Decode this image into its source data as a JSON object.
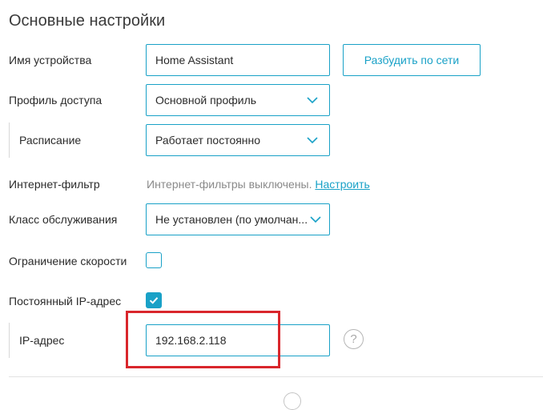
{
  "section": {
    "title": "Основные настройки"
  },
  "device_name": {
    "label": "Имя устройства",
    "value": "Home Assistant",
    "wol_button": "Разбудить по сети"
  },
  "access_profile": {
    "label": "Профиль доступа",
    "value": "Основной профиль"
  },
  "schedule": {
    "label": "Расписание",
    "value": "Работает постоянно"
  },
  "internet_filter": {
    "label": "Интернет-фильтр",
    "status": "Интернет-фильтры выключены.",
    "configure_link": "Настроить"
  },
  "service_class": {
    "label": "Класс обслуживания",
    "value": "Не установлен (по умолчан..."
  },
  "speed_limit": {
    "label": "Ограничение скорости",
    "checked": false
  },
  "static_ip": {
    "label": "Постоянный IP-адрес",
    "checked": true
  },
  "ip_address": {
    "label": "IP-адрес",
    "value": "192.168.2.118",
    "help_symbol": "?"
  },
  "colors": {
    "accent": "#19a1c7",
    "highlight": "#d9262c"
  },
  "icons": {
    "select": "chevron-down-icon",
    "checkbox": "checkmark-icon",
    "help": "question-circle-icon"
  }
}
